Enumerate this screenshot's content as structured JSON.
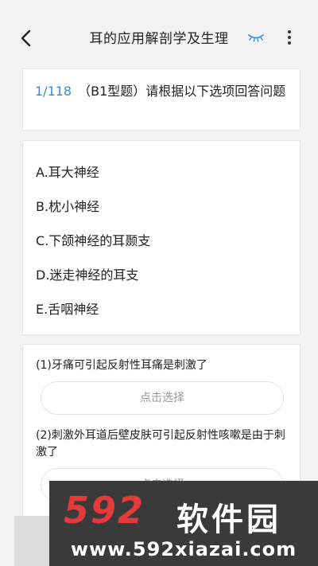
{
  "header": {
    "title": "耳的应用解剖学及生理"
  },
  "question": {
    "number": "1/118",
    "text": "（B1型题）请根据以下选项回答问题"
  },
  "options": [
    {
      "label": "A.耳大神经"
    },
    {
      "label": "B.枕小神经"
    },
    {
      "label": "C.下颌神经的耳颞支"
    },
    {
      "label": "D.迷走神经的耳支"
    },
    {
      "label": "E.舌咽神经"
    }
  ],
  "sub_questions": [
    {
      "text": "(1)牙痛可引起反射性耳痛是刺激了",
      "choose_label": "点击选择"
    },
    {
      "text": "(2)刺激外耳道后壁皮肤可引起反射性咳嗽是由于刺激了",
      "choose_label": "点击选择"
    }
  ],
  "watermark": {
    "logo": "592",
    "brand": "软件园",
    "url": "www.592xiazai.com"
  },
  "colors": {
    "accent": "#2d8ce3",
    "watermark_red": "#e33a3a"
  }
}
